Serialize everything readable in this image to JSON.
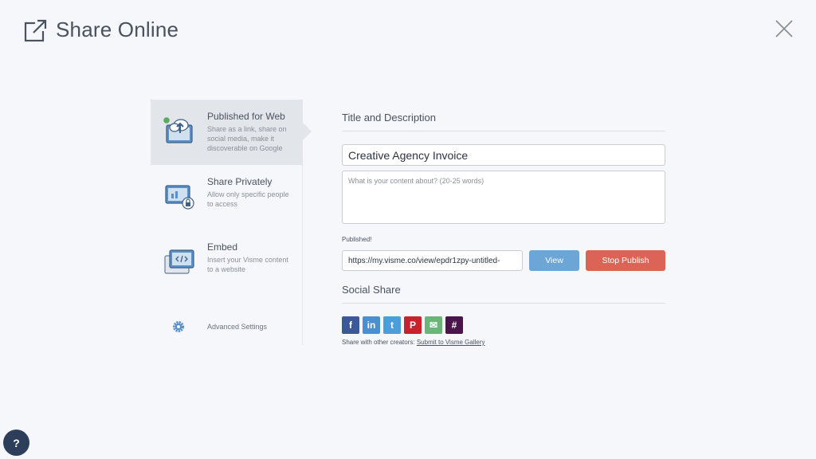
{
  "header": {
    "title": "Share Online",
    "icon": "external-link-icon"
  },
  "close": {
    "icon": "close-icon"
  },
  "menu": {
    "items": [
      {
        "label": "Published for Web",
        "desc": "Share as a link, share on social media, make it discoverable on Google",
        "icon": "cloud-upload-icon",
        "active": true,
        "status_color": "#5aab5f"
      },
      {
        "label": "Share Privately",
        "desc": "Allow only specific people to access",
        "icon": "lock-screen-icon"
      },
      {
        "label": "Embed",
        "desc": "Insert your Visme content to a website",
        "icon": "embed-code-icon"
      }
    ],
    "advanced": {
      "label": "Advanced Settings",
      "icon": "gear-icon"
    }
  },
  "panel": {
    "title_section": "Title and Description",
    "title_value": "Creative Agency Invoice",
    "desc_placeholder": "What is your content about? (20-25 words)",
    "published_label": "Published!",
    "url_value": "https://my.visme.co/view/epdr1zpy-untitled-",
    "view_label": "View",
    "stop_label": "Stop Publish",
    "social_title": "Social Share",
    "share_text": "Share with other creators:",
    "gallery_link": "Submit to Visme Gallery"
  },
  "social": [
    {
      "name": "facebook-icon",
      "glyph": "f",
      "color": "#3b5998"
    },
    {
      "name": "linkedin-icon",
      "glyph": "in",
      "color": "#4a8fcf"
    },
    {
      "name": "twitter-icon",
      "glyph": "t",
      "color": "#4a9fdb"
    },
    {
      "name": "pinterest-icon",
      "glyph": "P",
      "color": "#c8232c"
    },
    {
      "name": "email-icon",
      "glyph": "✉",
      "color": "#6cb47a"
    },
    {
      "name": "slack-icon",
      "glyph": "#",
      "color": "#4a154b"
    }
  ],
  "colors": {
    "accent": "#6ba6d6",
    "danger": "#dc6457",
    "background": "#f6f7fb",
    "help": "#2d3e5b"
  },
  "help": {
    "label": "?"
  }
}
